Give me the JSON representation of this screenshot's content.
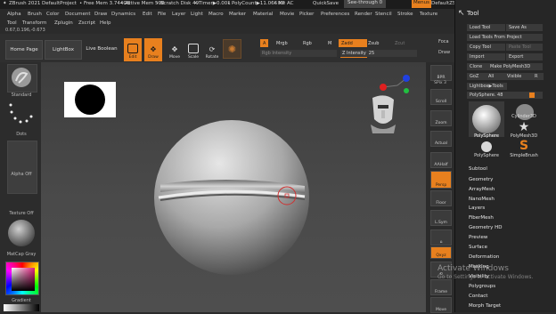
{
  "titlebar": {
    "app": "ZBrush 2021",
    "project": "DefaultProject",
    "free_mem": "• Free Mem 3.744GB",
    "active_mem": "• Active Mem 598",
    "scratch": "• Scratch Disk 49",
    "timer": "• Timer▶0.001",
    "polycount": "• PolyCount▶11.066 KP",
    "me": "• Me",
    "ac": "AC",
    "quicksave": "QuickSave",
    "see_through": "See-through  0",
    "menus": "Menus",
    "default_script": "DefaultZScript"
  },
  "menu": {
    "row1": [
      "Alpha",
      "Brush",
      "Color",
      "Document",
      "Draw",
      "Dynamics",
      "Edit",
      "File",
      "Layer",
      "Light",
      "Macro",
      "Marker",
      "Material",
      "Movie",
      "Picker",
      "Preferences",
      "Render",
      "Stencil",
      "Stroke",
      "Texture"
    ],
    "row2": [
      "Tool",
      "Transform",
      "Zplugin",
      "Zscript",
      "Help"
    ]
  },
  "coords": "0.67,0.196,-0.673",
  "toolbar": {
    "home_page": "Home Page",
    "lightbox": "LightBox",
    "live_boolean": "Live Boolean",
    "edit": "Edit",
    "draw": "Draw",
    "move": "Move",
    "scale": "Scale",
    "rotate": "Rotate",
    "a": "A",
    "mrgb": "Mrgb",
    "rgb": "Rgb",
    "m": "M",
    "zadd": "Zadd",
    "zsub": "Zsub",
    "zcut": "Zcut",
    "rgb_intensity": "Rgb Intensity",
    "z_intensity_label": "Z Intensity",
    "z_intensity_value": "25",
    "focal": "Foca",
    "draw_size": "Draw"
  },
  "left_shelf": {
    "brush": "Standard",
    "stroke": "Dots",
    "alpha": "Alpha Off",
    "texture": "Texture Off",
    "material": "MatCap Gray",
    "gradient": "Gradient"
  },
  "nav": {
    "bpr": "BPR",
    "spix": "SPix 3",
    "scroll": "Scroll",
    "zoom": "Zoom",
    "actual": "Actual",
    "aahalf": "AAHalf",
    "persp": "Persp",
    "floor": "Floor",
    "lsym": "L.Sym",
    "xyz": "Qxyz",
    "frame": "Frame",
    "move": "Move"
  },
  "palette": {
    "title": "Tool",
    "load_tool": "Load Tool",
    "save_as": "Save As",
    "load_from_project": "Load Tools From Project",
    "copy_tool": "Copy Tool",
    "paste_tool": "Paste Tool",
    "import": "Import",
    "export": "Export",
    "clone": "Clone",
    "make_polymesh": "Make PolyMesh3D",
    "goz": "GoZ",
    "all": "All",
    "visible": "Visible",
    "r": "R",
    "lightbox_tools": "Lightbox▶Tools",
    "polysphere_slider": "PolySphere. 48",
    "tiles": [
      "PolySphere",
      "Cylinder3D",
      "PolySphere",
      "PolyMesh3D",
      "PolySphere",
      "SimpleBrush"
    ],
    "subpalettes": [
      "Subtool",
      "Geometry",
      "ArrayMesh",
      "NanoMesh",
      "Layers",
      "FiberMesh",
      "Geometry HD",
      "Preview",
      "Surface",
      "Deformation",
      "Masking",
      "Visibility",
      "Polygroups",
      "Contact",
      "Morph Target"
    ]
  },
  "watermark": {
    "line1": "Activate Windows",
    "line2": "Go to Settings to activate Windows."
  },
  "colors": {
    "accent": "#e8801e",
    "panel": "#262626",
    "viewport": "#454545",
    "gizmo_red": "#e02020",
    "gizmo_green": "#20c040",
    "gizmo_blue": "#2040e0"
  }
}
